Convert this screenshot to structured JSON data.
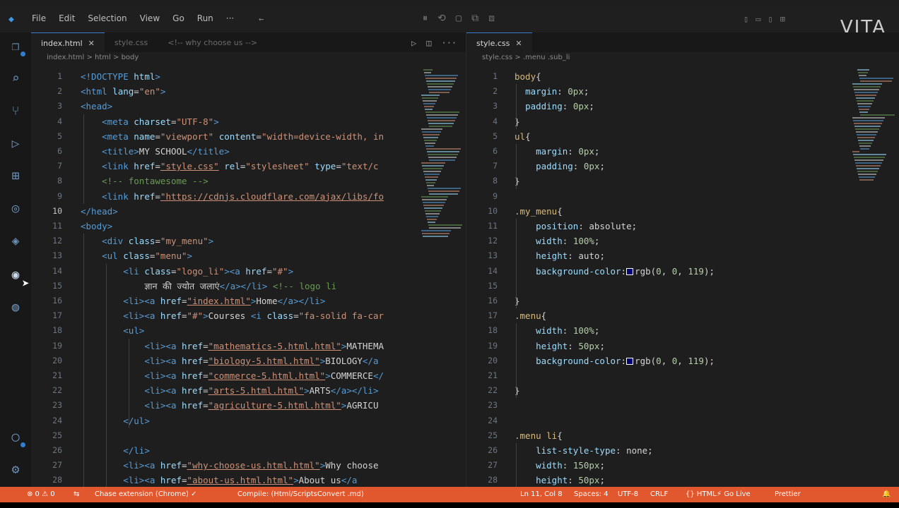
{
  "menu": [
    "File",
    "Edit",
    "Selection",
    "View",
    "Go",
    "Run",
    "···"
  ],
  "watermark": "VITA",
  "left_editor": {
    "tabs": [
      {
        "label": "index.html",
        "active": true,
        "close": "✕"
      },
      {
        "label": "style.css",
        "active": false
      },
      {
        "label": "<!-- why choose us -->",
        "active": false
      }
    ],
    "breadcrumb": "index.html > html > body",
    "lines": [
      {
        "n": "1",
        "html": "<span class='t-tag'>&lt;!DOCTYPE</span> <span class='t-attr'>html</span><span class='t-tag'>&gt;</span>"
      },
      {
        "n": "2",
        "html": "<span class='t-tag'>&lt;html</span> <span class='t-attr'>lang</span><span class='t-pun'>=</span><span class='t-str'>\"en\"</span><span class='t-tag'>&gt;</span>"
      },
      {
        "n": "3",
        "html": "<span class='t-tag'>&lt;head&gt;</span>"
      },
      {
        "n": "4",
        "html": "    <span class='t-tag'>&lt;meta</span> <span class='t-attr'>charset</span><span class='t-pun'>=</span><span class='t-str'>\"UTF-8\"</span><span class='t-tag'>&gt;</span>"
      },
      {
        "n": "5",
        "html": "    <span class='t-tag'>&lt;meta</span> <span class='t-attr'>name</span><span class='t-pun'>=</span><span class='t-str'>\"viewport\"</span> <span class='t-attr'>content</span><span class='t-pun'>=</span><span class='t-str'>\"width=device-width, in</span>"
      },
      {
        "n": "6",
        "html": "    <span class='t-tag'>&lt;title&gt;</span><span class='t-txt'>MY SCHOOL</span><span class='t-tag'>&lt;/title&gt;</span>"
      },
      {
        "n": "7",
        "html": "    <span class='t-tag'>&lt;link</span> <span class='t-attr'>href</span><span class='t-pun'>=</span><span class='t-link'>\"style.css\"</span> <span class='t-attr'>rel</span><span class='t-pun'>=</span><span class='t-str'>\"stylesheet\"</span> <span class='t-attr'>type</span><span class='t-pun'>=</span><span class='t-str'>\"text/c</span>"
      },
      {
        "n": "8",
        "html": "    <span class='t-com'>&lt;!-- fontawesome --&gt;</span>"
      },
      {
        "n": "9",
        "html": "    <span class='t-tag'>&lt;link</span> <span class='t-attr'>href</span><span class='t-pun'>=</span><span class='t-link'>\"https://cdnjs.cloudflare.com/ajax/libs/fo</span>"
      },
      {
        "n": "10",
        "cur": true,
        "html": "<span class='t-tag'>&lt;/head&gt;</span>"
      },
      {
        "n": "11",
        "html": "<span class='t-tag'>&lt;body&gt;</span>"
      },
      {
        "n": "12",
        "html": "    <span class='t-tag'>&lt;div</span> <span class='t-attr'>class</span><span class='t-pun'>=</span><span class='t-str'>\"my_menu\"</span><span class='t-tag'>&gt;</span>"
      },
      {
        "n": "13",
        "html": "    <span class='t-tag'>&lt;ul</span> <span class='t-attr'>class</span><span class='t-pun'>=</span><span class='t-str'>\"menu\"</span><span class='t-tag'>&gt;</span>"
      },
      {
        "n": "14",
        "html": "        <span class='t-tag'>&lt;li</span> <span class='t-attr'>class</span><span class='t-pun'>=</span><span class='t-str'>\"logo_li\"</span><span class='t-tag'>&gt;&lt;a</span> <span class='t-attr'>href</span><span class='t-pun'>=</span><span class='t-str'>\"#\"</span><span class='t-tag'>&gt;</span>"
      },
      {
        "n": "15",
        "html": "            <span class='t-txt'>ज्ञान की ज्योत जलाएं</span><span class='t-tag'>&lt;/a&gt;&lt;/li&gt;</span> <span class='t-com'>&lt;!-- logo li</span>"
      },
      {
        "n": "16",
        "html": "        <span class='t-tag'>&lt;li&gt;&lt;a</span> <span class='t-attr'>href</span><span class='t-pun'>=</span><span class='t-link'>\"index.html\"</span><span class='t-tag'>&gt;</span><span class='t-txt'>Home</span><span class='t-tag'>&lt;/a&gt;&lt;/li&gt;</span>"
      },
      {
        "n": "17",
        "html": "        <span class='t-tag'>&lt;li&gt;&lt;a</span> <span class='t-attr'>href</span><span class='t-pun'>=</span><span class='t-str'>\"#\"</span><span class='t-tag'>&gt;</span><span class='t-txt'>Courses</span> <span class='t-tag'>&lt;i</span> <span class='t-attr'>class</span><span class='t-pun'>=</span><span class='t-str'>\"fa-solid fa-car</span>"
      },
      {
        "n": "18",
        "html": "        <span class='t-tag'>&lt;ul&gt;</span>"
      },
      {
        "n": "19",
        "html": "            <span class='t-tag'>&lt;li&gt;&lt;a</span> <span class='t-attr'>href</span><span class='t-pun'>=</span><span class='t-link'>\"mathematics-5.html.html\"</span><span class='t-tag'>&gt;</span><span class='t-txt'>MATHEMA</span>"
      },
      {
        "n": "20",
        "html": "            <span class='t-tag'>&lt;li&gt;&lt;a</span> <span class='t-attr'>href</span><span class='t-pun'>=</span><span class='t-link'>\"biology-5.html.html\"</span><span class='t-tag'>&gt;</span><span class='t-txt'>BIOLOGY</span><span class='t-tag'>&lt;/a</span>"
      },
      {
        "n": "21",
        "html": "            <span class='t-tag'>&lt;li&gt;&lt;a</span> <span class='t-attr'>href</span><span class='t-pun'>=</span><span class='t-link'>\"commerce-5.html.html\"</span><span class='t-tag'>&gt;</span><span class='t-txt'>COMMERCE</span><span class='t-tag'>&lt;/</span>"
      },
      {
        "n": "22",
        "html": "            <span class='t-tag'>&lt;li&gt;&lt;a</span> <span class='t-attr'>href</span><span class='t-pun'>=</span><span class='t-link'>\"arts-5.html.html\"</span><span class='t-tag'>&gt;</span><span class='t-txt'>ARTS</span><span class='t-tag'>&lt;/a&gt;&lt;/li&gt;</span>"
      },
      {
        "n": "23",
        "html": "            <span class='t-tag'>&lt;li&gt;&lt;a</span> <span class='t-attr'>href</span><span class='t-pun'>=</span><span class='t-link'>\"agriculture-5.html.html\"</span><span class='t-tag'>&gt;</span><span class='t-txt'>AGRICU</span>"
      },
      {
        "n": "24",
        "html": "        <span class='t-tag'>&lt;/ul&gt;</span>"
      },
      {
        "n": "25",
        "html": ""
      },
      {
        "n": "26",
        "html": "        <span class='t-tag'>&lt;/li&gt;</span>"
      },
      {
        "n": "27",
        "html": "        <span class='t-tag'>&lt;li&gt;&lt;a</span> <span class='t-attr'>href</span><span class='t-pun'>=</span><span class='t-link'>\"why-choose-us.html.html\"</span><span class='t-tag'>&gt;</span><span class='t-txt'>Why choose</span>"
      },
      {
        "n": "28",
        "html": "        <span class='t-tag'>&lt;li&gt;&lt;a</span> <span class='t-attr'>href</span><span class='t-pun'>=</span><span class='t-link'>\"about-us.html.html\"</span><span class='t-tag'>&gt;</span><span class='t-txt'>About us</span><span class='t-tag'>&lt;/a</span>"
      }
    ]
  },
  "right_editor": {
    "tabs": [
      {
        "label": "style.css",
        "active": true,
        "close": "✕"
      }
    ],
    "breadcrumb": "style.css > .menu .sub_li",
    "lines": [
      {
        "n": "1",
        "html": "<span class='t-sel'>body</span><span class='t-pun'>{</span>"
      },
      {
        "n": "2",
        "html": "  <span class='t-prop'>margin</span><span class='t-pun'>:</span> <span class='t-num'>0px</span><span class='t-pun'>;</span>"
      },
      {
        "n": "3",
        "html": "  <span class='t-prop'>padding</span><span class='t-pun'>:</span> <span class='t-num'>0px</span><span class='t-pun'>;</span>"
      },
      {
        "n": "4",
        "html": "<span class='t-pun'>}</span>"
      },
      {
        "n": "5",
        "html": "<span class='t-sel'>ul</span><span class='t-pun'>{</span>"
      },
      {
        "n": "6",
        "html": "    <span class='t-prop'>margin</span><span class='t-pun'>:</span> <span class='t-num'>0px</span><span class='t-pun'>;</span>"
      },
      {
        "n": "7",
        "html": "    <span class='t-prop'>padding</span><span class='t-pun'>:</span> <span class='t-num'>0px</span><span class='t-pun'>;</span>"
      },
      {
        "n": "8",
        "html": "<span class='t-pun'>}</span>"
      },
      {
        "n": "9",
        "html": ""
      },
      {
        "n": "10",
        "html": "<span class='t-sel'>.my_menu</span><span class='t-pun'>{</span>"
      },
      {
        "n": "11",
        "html": "    <span class='t-prop'>position</span><span class='t-pun'>:</span> <span class='t-txt'>absolute</span><span class='t-pun'>;</span>"
      },
      {
        "n": "12",
        "html": "    <span class='t-prop'>width</span><span class='t-pun'>:</span> <span class='t-num'>100%</span><span class='t-pun'>;</span>"
      },
      {
        "n": "13",
        "html": "    <span class='t-prop'>height</span><span class='t-pun'>:</span> <span class='t-txt'>auto</span><span class='t-pun'>;</span>"
      },
      {
        "n": "14",
        "html": "    <span class='t-prop'>background-color</span><span class='t-pun'>:</span><span class='swatch'></span><span class='t-txt'>rgb(</span><span class='t-num'>0</span><span class='t-pun'>,</span> <span class='t-num'>0</span><span class='t-pun'>,</span> <span class='t-num'>119</span><span class='t-txt'>)</span><span class='t-pun'>;</span>"
      },
      {
        "n": "15",
        "html": ""
      },
      {
        "n": "16",
        "html": "<span class='t-pun'>}</span>"
      },
      {
        "n": "17",
        "html": "<span class='t-sel'>.menu</span><span class='t-pun'>{</span>"
      },
      {
        "n": "18",
        "html": "    <span class='t-prop'>width</span><span class='t-pun'>:</span> <span class='t-num'>100%</span><span class='t-pun'>;</span>"
      },
      {
        "n": "19",
        "html": "    <span class='t-prop'>height</span><span class='t-pun'>:</span> <span class='t-num'>50px</span><span class='t-pun'>;</span>"
      },
      {
        "n": "20",
        "html": "    <span class='t-prop'>background-color</span><span class='t-pun'>:</span><span class='swatch'></span><span class='t-txt'>rgb(</span><span class='t-num'>0</span><span class='t-pun'>,</span> <span class='t-num'>0</span><span class='t-pun'>,</span> <span class='t-num'>119</span><span class='t-txt'>)</span><span class='t-pun'>;</span>"
      },
      {
        "n": "21",
        "html": ""
      },
      {
        "n": "22",
        "html": "<span class='t-pun'>}</span>"
      },
      {
        "n": "23",
        "html": ""
      },
      {
        "n": "24",
        "html": ""
      },
      {
        "n": "25",
        "html": "<span class='t-sel'>.menu li</span><span class='t-pun'>{</span>"
      },
      {
        "n": "26",
        "html": "    <span class='t-prop'>list-style-type</span><span class='t-pun'>:</span> <span class='t-txt'>none</span><span class='t-pun'>;</span>"
      },
      {
        "n": "27",
        "html": "    <span class='t-prop'>width</span><span class='t-pun'>:</span> <span class='t-num'>150px</span><span class='t-pun'>;</span>"
      },
      {
        "n": "28",
        "html": "    <span class='t-prop'>height</span><span class='t-pun'>:</span> <span class='t-num'>50px</span><span class='t-pun'>;</span>"
      }
    ]
  },
  "statusbar": {
    "left": [
      "⊗ 0 ⚠ 0",
      "⇆",
      "Chase extension (Chrome) ✓",
      "Compile: (Html/ScriptsConvert .md)"
    ],
    "right": [
      "Ln 11, Col 8",
      "Spaces: 4",
      "UTF-8",
      "CRLF",
      "{} HTML",
      "⚡ Go Live",
      "Prettier"
    ]
  },
  "icons": {
    "explorer": "files-icon",
    "search": "search-icon",
    "source_control": "source-control-icon",
    "run_debug": "run-debug-icon",
    "extensions": "extensions-icon",
    "accounts": "account-icon",
    "settings": "gear-icon"
  }
}
